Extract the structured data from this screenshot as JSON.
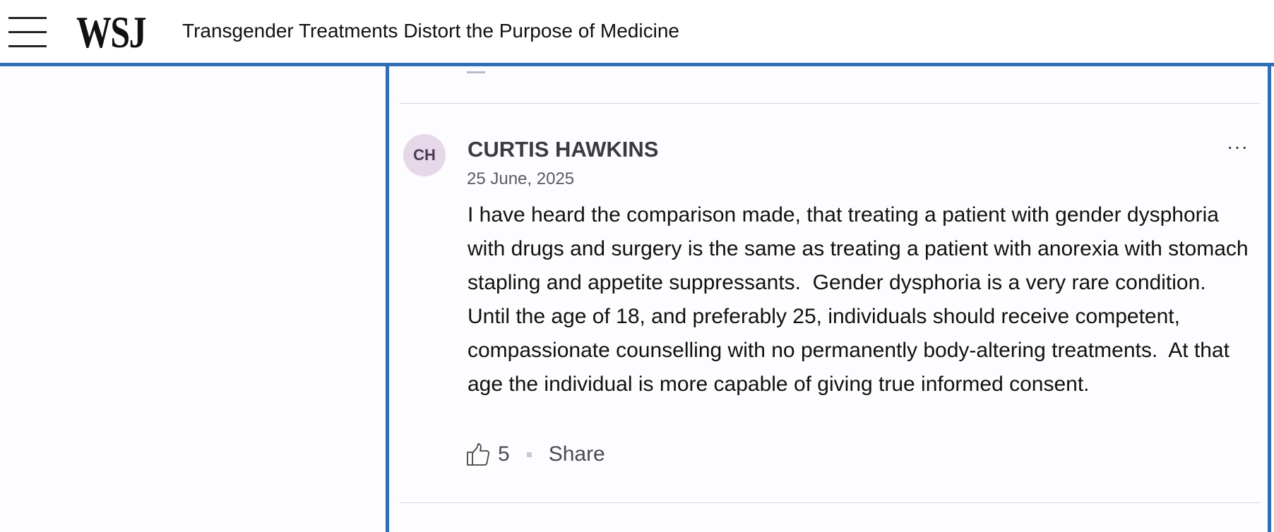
{
  "header": {
    "logo": "WSJ",
    "article_title": "Transgender Treatments Distort the Purpose of Medicine"
  },
  "comment": {
    "avatar_initials": "CH",
    "author": "CURTIS HAWKINS",
    "date": "25 June, 2025",
    "text": "I have heard the comparison made, that treating a patient with gender dysphoria with drugs and surgery is the same as treating a patient with anorexia with stomach stapling and appetite suppressants.  Gender dysphoria is a very rare condition.  Until the age of 18, and preferably 25, individuals should receive competent, compassionate counselling with no permanently body-altering treatments.  At that age the individual is more capable of giving true informed consent.",
    "more_label": "···",
    "likes": "5",
    "share_label": "Share"
  },
  "colors": {
    "accent_border": "#2f6fb5",
    "avatar_bg": "#e6d8e8"
  },
  "icons": {
    "menu": "hamburger-menu-icon",
    "like": "thumbs-up-icon",
    "more": "more-options-icon"
  }
}
